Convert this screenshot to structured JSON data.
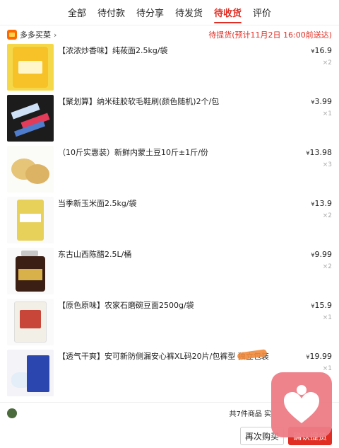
{
  "tabs": [
    {
      "label": "全部",
      "active": false
    },
    {
      "label": "待付款",
      "active": false
    },
    {
      "label": "待分享",
      "active": false
    },
    {
      "label": "待发货",
      "active": false
    },
    {
      "label": "待收货",
      "active": true
    },
    {
      "label": "评价",
      "active": false
    }
  ],
  "shop": {
    "name": "多多买菜",
    "chevron": "›",
    "status": "待提货(预计11月2日 16:00前送达)"
  },
  "items": [
    {
      "title": "【浓浓炒香味】纯莜面2.5kg/袋",
      "currency": "¥",
      "price": "16.9",
      "qty": "×2"
    },
    {
      "title": "【聚划算】纳米硅胶软毛鞋刷(颜色随机)2个/包",
      "currency": "¥",
      "price": "3.99",
      "qty": "×1"
    },
    {
      "title": "（10斤实惠装）新鲜内蒙土豆10斤±1斤/份",
      "currency": "¥",
      "price": "13.98",
      "qty": "×3"
    },
    {
      "title": "当季新玉米面2.5kg/袋",
      "currency": "¥",
      "price": "13.9",
      "qty": "×2"
    },
    {
      "title": "东古山西陈醋2.5L/桶",
      "currency": "¥",
      "price": "9.99",
      "qty": "×2"
    },
    {
      "title": "【原色原味】农家石磨碗豆面2500g/袋",
      "currency": "¥",
      "price": "15.9",
      "qty": "×1"
    },
    {
      "title": "【透气干爽】安可新防侧漏安心裤XL码20片/包裤型 独立包装",
      "currency": "¥",
      "price": "19.99",
      "qty": "×1"
    }
  ],
  "footer": {
    "total": "共7件商品 实"
  },
  "actions": {
    "rebuy": "再次购买",
    "confirm": "确认提货"
  },
  "colors": {
    "accent": "#e02e24",
    "bubble": "#ee7d86"
  },
  "icons": {
    "shop": "shop-logo-icon",
    "heart": "heart-icon"
  }
}
